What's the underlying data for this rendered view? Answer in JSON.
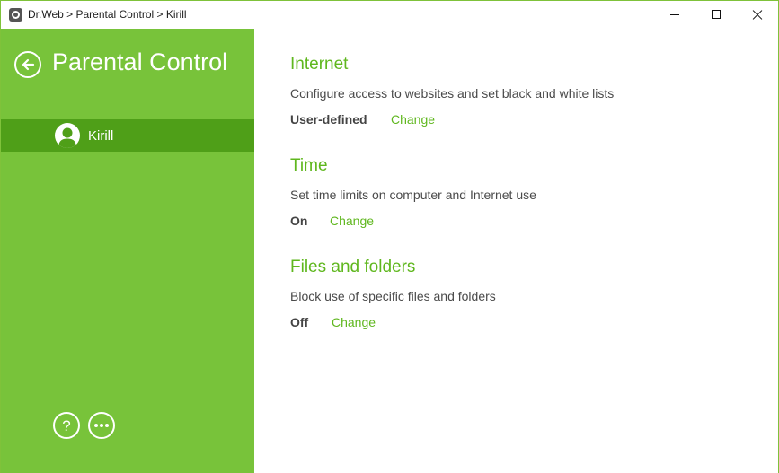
{
  "window": {
    "title": "Dr.Web > Parental Control > Kirill"
  },
  "sidebar": {
    "title": "Parental Control",
    "selected_user": "Kirill",
    "help_glyph": "?",
    "colors": {
      "background": "#78c33a",
      "selected": "#4f9f18"
    }
  },
  "sections": [
    {
      "title": "Internet",
      "description": "Configure access to websites and set black and white lists",
      "status": "User-defined",
      "action": "Change"
    },
    {
      "title": "Time",
      "description": "Set time limits on computer and Internet use",
      "status": "On",
      "action": "Change"
    },
    {
      "title": "Files and folders",
      "description": "Block use of specific files and folders",
      "status": "Off",
      "action": "Change"
    }
  ],
  "accent_color": "#5fb71e"
}
